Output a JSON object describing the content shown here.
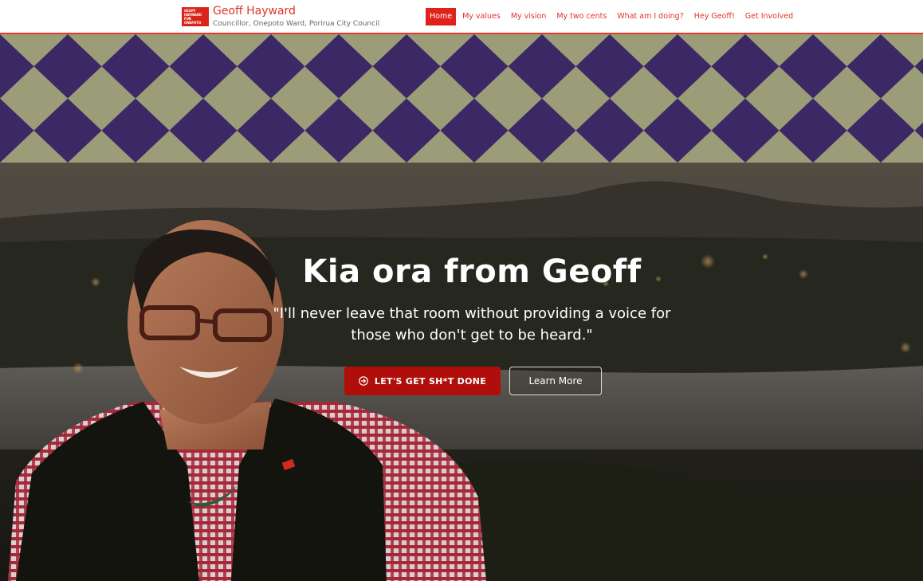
{
  "header": {
    "logo_lines": [
      "GEOFF",
      "HAYWARD",
      "FOR ONEPOTO"
    ],
    "site_name": "Geoff Hayward",
    "site_tagline": "Councillor, Onepoto Ward, Porirua City Council"
  },
  "nav": {
    "items": [
      {
        "label": "Home",
        "active": true
      },
      {
        "label": "My values",
        "active": false
      },
      {
        "label": "My vision",
        "active": false
      },
      {
        "label": "My two cents",
        "active": false
      },
      {
        "label": "What am I doing?",
        "active": false
      },
      {
        "label": "Hey Geoff!",
        "active": false
      },
      {
        "label": "Get Involved",
        "active": false
      }
    ]
  },
  "hero": {
    "title": "Kia ora from Geoff",
    "quote": "\"I'll never leave that room without providing a voice for those who don't get to be heard.\"",
    "primary_button": {
      "label": "LET'S GET SH*T DONE",
      "icon": "arrow-circle-right-icon"
    },
    "secondary_button": {
      "label": "Learn More"
    }
  },
  "colors": {
    "brand_red": "#e23325",
    "button_red": "#b00e0a",
    "pattern_purple": "#3b2865",
    "pattern_sage": "#9b9c78"
  }
}
